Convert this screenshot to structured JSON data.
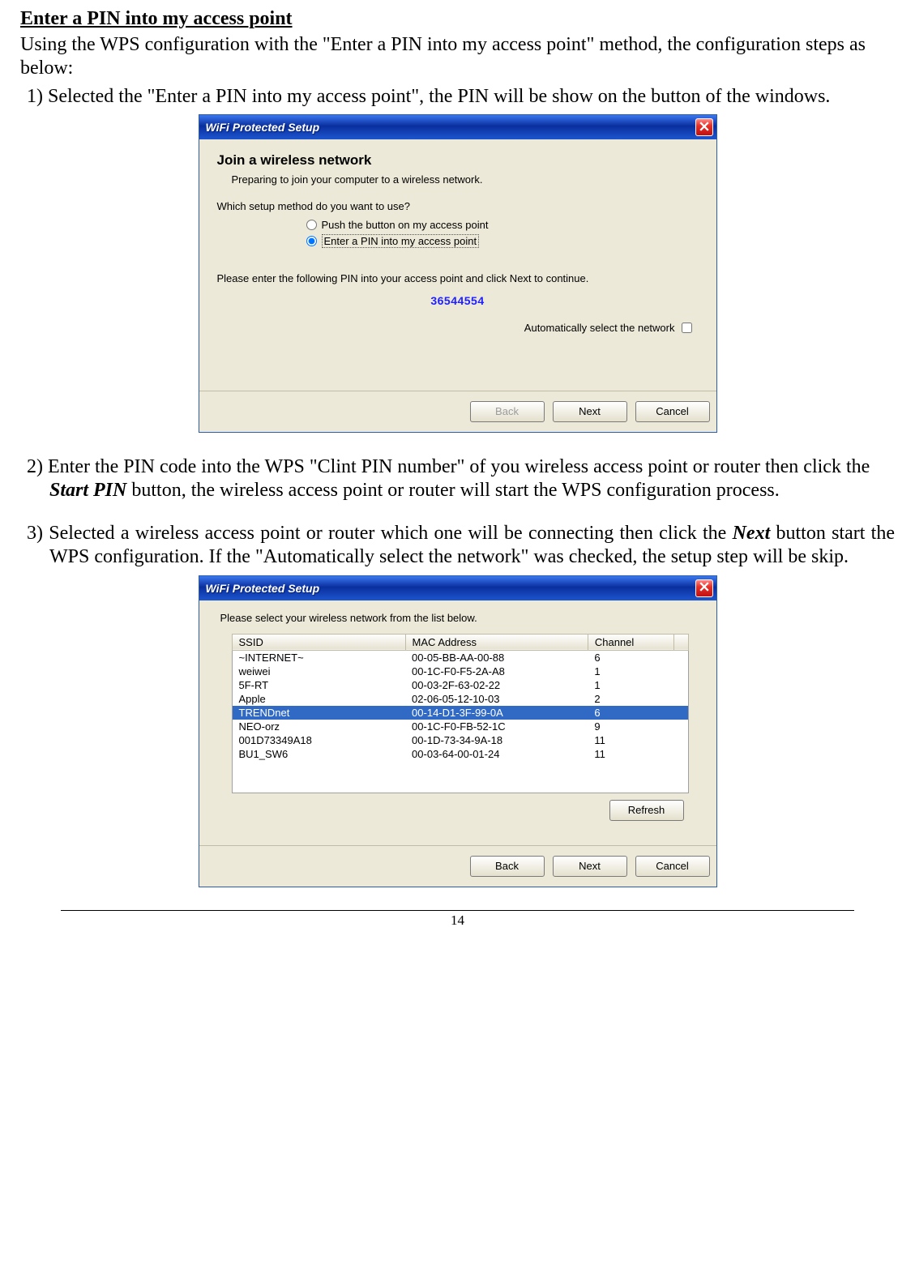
{
  "heading": "Enter a PIN into my access point",
  "intro": "Using the WPS configuration with the \"Enter a PIN into my access point\" method, the configuration steps as below:",
  "step1": {
    "num": "1)",
    "text_a": "Selected the \"Enter a PIN into my access point\", the PIN will be show on the button of the windows."
  },
  "dialog1": {
    "title": "WiFi Protected Setup",
    "join_title": "Join a wireless network",
    "join_sub": "Preparing to join your computer to a wireless network.",
    "question": "Which setup method do you want to use?",
    "radio_push": "Push the button on my access point",
    "radio_pin": "Enter a PIN into my access point",
    "pin_instr": "Please enter the following PIN into your access point and click Next to continue.",
    "pin_value": "36544554",
    "auto_label": "Automatically select the network",
    "btn_back": "Back",
    "btn_next": "Next",
    "btn_cancel": "Cancel"
  },
  "step2": {
    "num": "2)",
    "text_a": "Enter the PIN code into the WPS \"Clint PIN number\" of you wireless access point or router then click the  ",
    "start_pin": "Start PIN",
    "text_b": " button, the wireless access point or router will start the WPS configuration process."
  },
  "step3": {
    "num": "3)",
    "text_a": "Selected a wireless access point or router which one will be connecting then click the ",
    "next_ital": "Next",
    "text_b": " button start the WPS configuration. If the \"Automatically select the network\" was checked, the setup step will be skip."
  },
  "dialog2": {
    "title": "WiFi Protected Setup",
    "instr": "Please select your wireless network from the list below.",
    "headers": {
      "ssid": "SSID",
      "mac": "MAC Address",
      "chan": "Channel"
    },
    "rows": [
      {
        "ssid": "~INTERNET~",
        "mac": "00-05-BB-AA-00-88",
        "chan": "6",
        "sel": false
      },
      {
        "ssid": "weiwei",
        "mac": "00-1C-F0-F5-2A-A8",
        "chan": "1",
        "sel": false
      },
      {
        "ssid": "5F-RT",
        "mac": "00-03-2F-63-02-22",
        "chan": "1",
        "sel": false
      },
      {
        "ssid": "Apple",
        "mac": "02-06-05-12-10-03",
        "chan": "2",
        "sel": false
      },
      {
        "ssid": "TRENDnet",
        "mac": "00-14-D1-3F-99-0A",
        "chan": "6",
        "sel": true
      },
      {
        "ssid": "NEO-orz",
        "mac": "00-1C-F0-FB-52-1C",
        "chan": "9",
        "sel": false
      },
      {
        "ssid": "001D73349A18",
        "mac": "00-1D-73-34-9A-18",
        "chan": "11",
        "sel": false
      },
      {
        "ssid": "BU1_SW6",
        "mac": "00-03-64-00-01-24",
        "chan": "11",
        "sel": false
      }
    ],
    "btn_refresh": "Refresh",
    "btn_back": "Back",
    "btn_next": "Next",
    "btn_cancel": "Cancel"
  },
  "page_num": "14"
}
